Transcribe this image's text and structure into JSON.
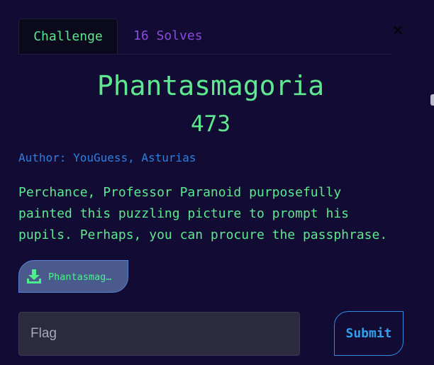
{
  "tabs": {
    "challenge": "Challenge",
    "solves": "16 Solves"
  },
  "close": {
    "icon": "close-icon",
    "glyph": "×"
  },
  "challenge": {
    "name": "Phantasmagoria",
    "value": "473",
    "author": "Author: YouGuess, Asturias",
    "description_lines": [
      "Perchance, Professor Paranoid purposefully",
      "painted this puzzling picture to prompt his",
      "pupils. Perhaps, you can procure the passphrase."
    ]
  },
  "file": {
    "icon": "download-icon",
    "label": "Phantasmag…"
  },
  "submission": {
    "placeholder": "Flag",
    "value": "",
    "submit_label": "Submit"
  },
  "colors": {
    "background": "#120b34",
    "accent_green": "#5ee88f",
    "accent_purple": "#8a4bdc",
    "accent_blue": "#2f8ae0"
  }
}
